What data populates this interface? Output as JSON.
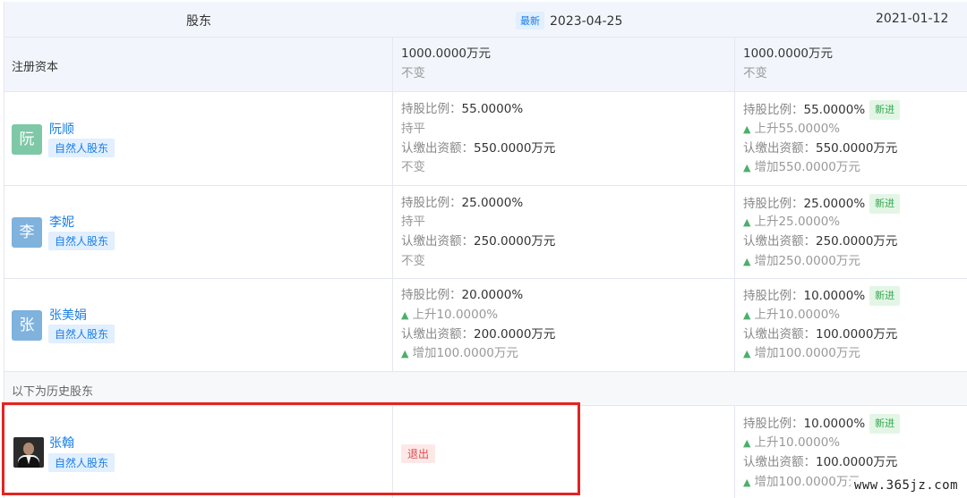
{
  "header": {
    "col_shareholder": "股东",
    "latest_badge": "最新",
    "date_latest": "2023-04-25",
    "date_prev": "2021-01-12"
  },
  "registered_capital": {
    "label": "注册资本",
    "latest_value": "1000.0000万元",
    "latest_change": "不变",
    "prev_value": "1000.0000万元",
    "prev_change": "不变"
  },
  "keys": {
    "ratio": "持股比例：",
    "amount": "认缴出资额："
  },
  "shareholders": [
    {
      "avatar_char": "阮",
      "avatar_color": "#7ec8a7",
      "name": "阮顺",
      "tag": "自然人股东",
      "latest": {
        "ratio": "55.0000%",
        "ratio_change": "持平",
        "amount": "550.0000万元",
        "amount_change": "不变"
      },
      "prev": {
        "ratio": "55.0000%",
        "badge": "新进",
        "ratio_change": "上升55.0000%",
        "amount": "550.0000万元",
        "amount_change": "增加550.0000万元"
      }
    },
    {
      "avatar_char": "李",
      "avatar_color": "#7fb2dd",
      "name": "李妮",
      "tag": "自然人股东",
      "latest": {
        "ratio": "25.0000%",
        "ratio_change": "持平",
        "amount": "250.0000万元",
        "amount_change": "不变"
      },
      "prev": {
        "ratio": "25.0000%",
        "badge": "新进",
        "ratio_change": "上升25.0000%",
        "amount": "250.0000万元",
        "amount_change": "增加250.0000万元"
      }
    },
    {
      "avatar_char": "张",
      "avatar_color": "#7fb2dd",
      "name": "张美娟",
      "tag": "自然人股东",
      "latest": {
        "ratio": "20.0000%",
        "ratio_change": "上升10.0000%",
        "amount": "200.0000万元",
        "amount_change": "增加100.0000万元"
      },
      "prev": {
        "ratio": "10.0000%",
        "badge": "新进",
        "ratio_change": "上升10.0000%",
        "amount": "100.0000万元",
        "amount_change": "增加100.0000万元"
      }
    }
  ],
  "history": {
    "label": "以下为历史股东",
    "shareholder": {
      "name": "张翰",
      "tag": "自然人股东",
      "latest_status": "退出",
      "prev": {
        "ratio": "10.0000%",
        "badge": "新进",
        "ratio_change": "上升10.0000%",
        "amount": "100.0000万元",
        "amount_change": "增加100.0000万元"
      }
    }
  },
  "colors": {
    "link": "#1b7ee6",
    "up_arrow": "#4caf6a",
    "highlight_border": "#e52222"
  },
  "watermark": "www.365jz.com"
}
